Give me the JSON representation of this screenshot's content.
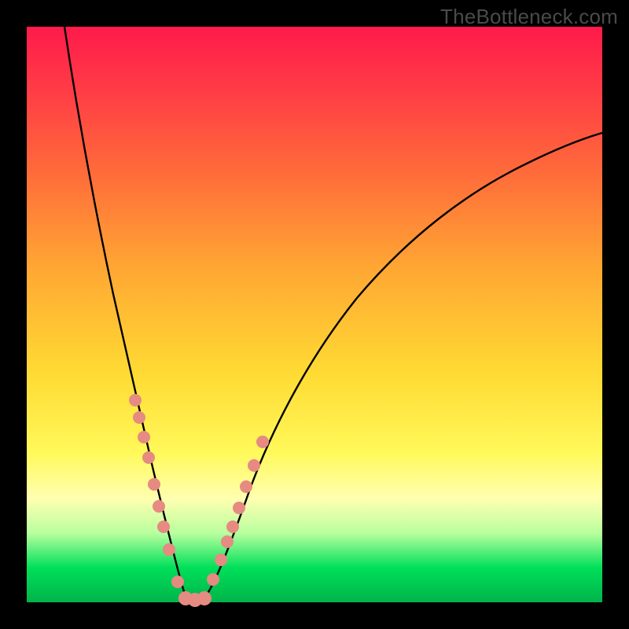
{
  "watermark": "TheBottleneck.com",
  "colors": {
    "frame": "#000000",
    "gradient_top": "#ff1a4b",
    "gradient_mid": "#ffda33",
    "gradient_bottom": "#00b44a",
    "curve": "#000000",
    "bead": "#e68a82"
  },
  "chart_data": {
    "type": "line",
    "title": "",
    "xlabel": "",
    "ylabel": "",
    "xlim": [
      0,
      100
    ],
    "ylim": [
      0,
      100
    ],
    "note": "Axes are unlabeled; V-shaped bottleneck curve with minimum near x≈27. y is read as distance from bottom (0 = bottom green band, 100 = top red). Values are visual estimates from curve position against the gradient.",
    "series": [
      {
        "name": "left-branch",
        "x": [
          6,
          8,
          10,
          12,
          14,
          16,
          18,
          20,
          22,
          24,
          26,
          27
        ],
        "y": [
          100,
          90,
          80,
          70,
          60,
          49,
          38,
          27,
          17,
          9,
          2,
          0
        ]
      },
      {
        "name": "right-branch",
        "x": [
          30,
          32,
          35,
          40,
          45,
          50,
          55,
          60,
          65,
          70,
          75,
          80,
          85,
          90,
          95,
          100
        ],
        "y": [
          0,
          4,
          11,
          22,
          32,
          40,
          47,
          53,
          58,
          63,
          67,
          71,
          74,
          77,
          79,
          81
        ]
      }
    ],
    "beads": {
      "note": "Pink marker dots clustered along the curve in the lower band (roughly y ∈ [0, 30]).",
      "left_branch_x": [
        18.0,
        18.6,
        19.3,
        20.2,
        21.2,
        22.0,
        22.8,
        23.8,
        25.4,
        27.0
      ],
      "left_branch_y": [
        37,
        34,
        30,
        26,
        20,
        16,
        12,
        8,
        2,
        0
      ],
      "right_branch_x": [
        30.0,
        31.8,
        33.2,
        34.2,
        35.0,
        36.3,
        37.7,
        39.0,
        40.5
      ],
      "right_branch_y": [
        0,
        4,
        8,
        11,
        13,
        17,
        21,
        25,
        29
      ],
      "flat_bottom_x": [
        27.0,
        28.5,
        30.0
      ],
      "flat_bottom_y": [
        0,
        0,
        0
      ]
    }
  }
}
